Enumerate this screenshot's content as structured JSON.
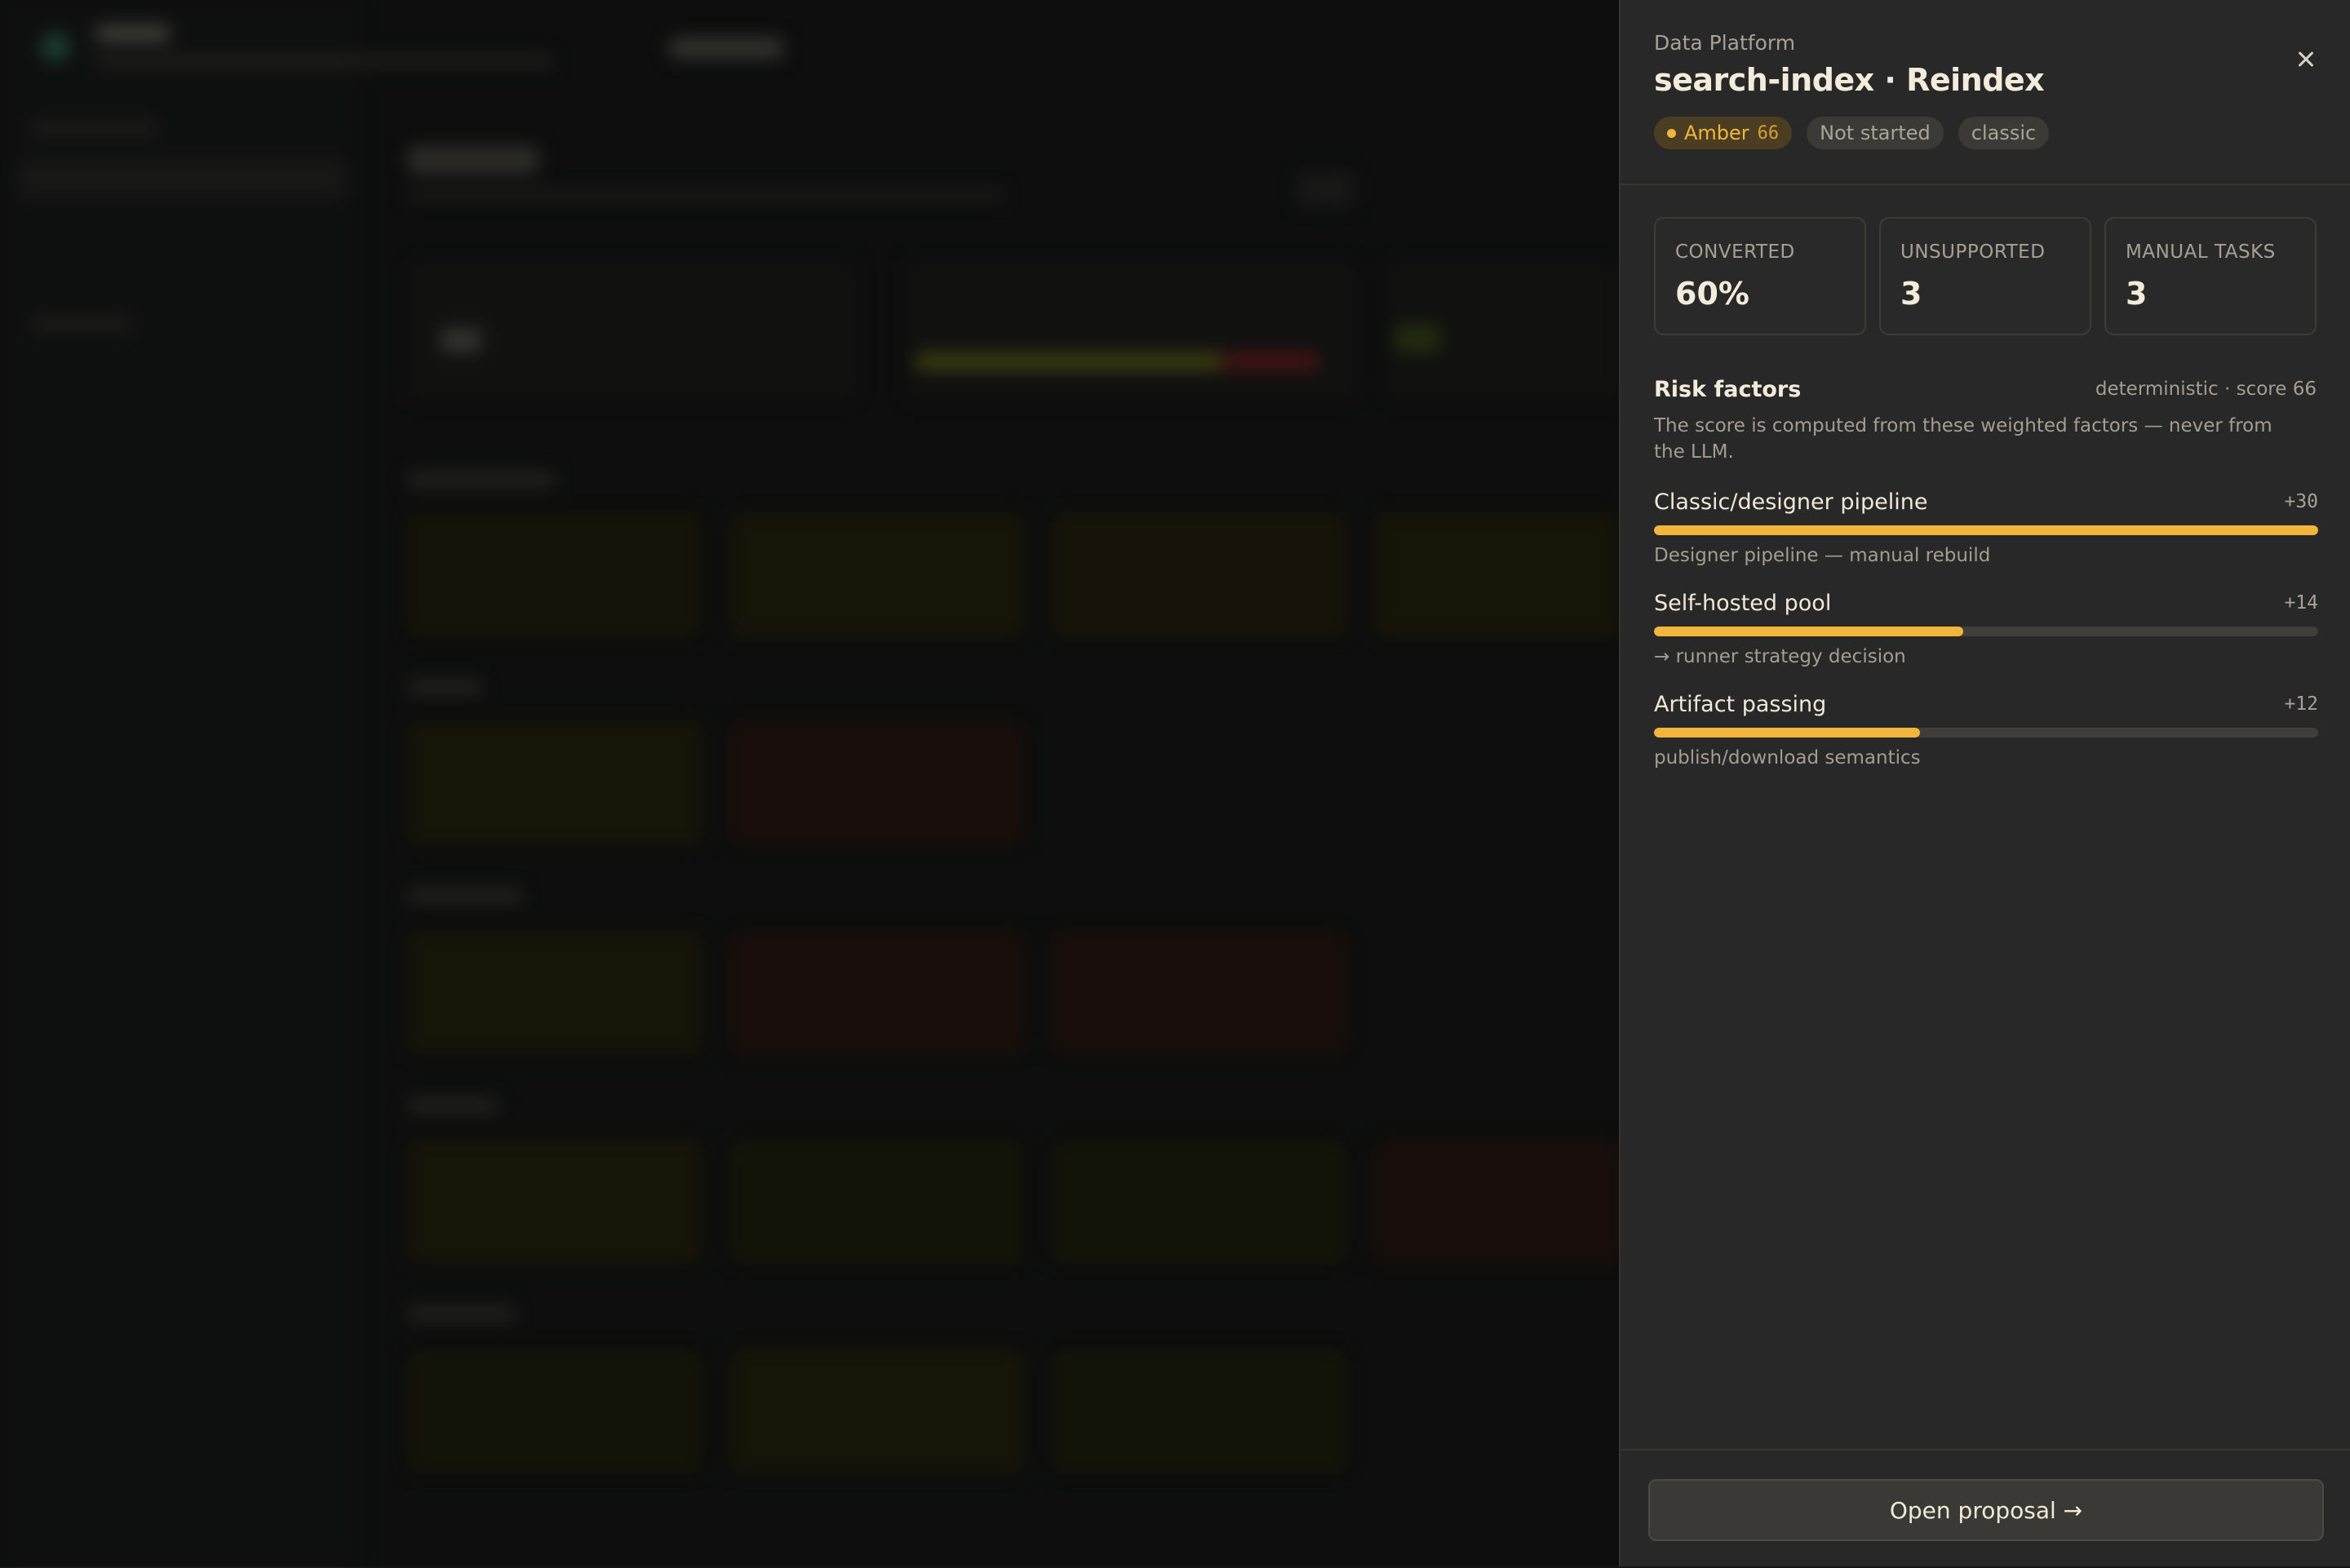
{
  "drawer": {
    "eyebrow": "Data Platform",
    "title": "search-index · Reindex",
    "tags": {
      "risk_label": "Amber",
      "risk_score": "66",
      "status": "Not started",
      "type": "classic"
    },
    "stats": [
      {
        "label": "CONVERTED",
        "value": "60%"
      },
      {
        "label": "UNSUPPORTED",
        "value": "3"
      },
      {
        "label": "MANUAL TASKS",
        "value": "3"
      }
    ],
    "risk_factors": {
      "title": "Risk factors",
      "meta": "deterministic · score 66",
      "description": "The score is computed from these weighted factors — never from the LLM.",
      "items": [
        {
          "name": "Classic/designer pipeline",
          "weight": "+30",
          "fill": 1.0,
          "note": "Designer pipeline — manual rebuild"
        },
        {
          "name": "Self-hosted pool",
          "weight": "+14",
          "fill": 0.466,
          "note": "→ runner strategy decision"
        },
        {
          "name": "Artifact passing",
          "weight": "+12",
          "fill": 0.4,
          "note": "publish/download semantics"
        }
      ]
    },
    "footer": {
      "open_label": "Open proposal →"
    }
  },
  "colors": {
    "accent_amber": "#f2b63c",
    "panel_bg": "#282828",
    "text_primary": "#f4ecdb",
    "text_muted": "#a49d92"
  },
  "icons": {
    "close": "close-icon",
    "status_dot": "amber-dot-icon"
  }
}
